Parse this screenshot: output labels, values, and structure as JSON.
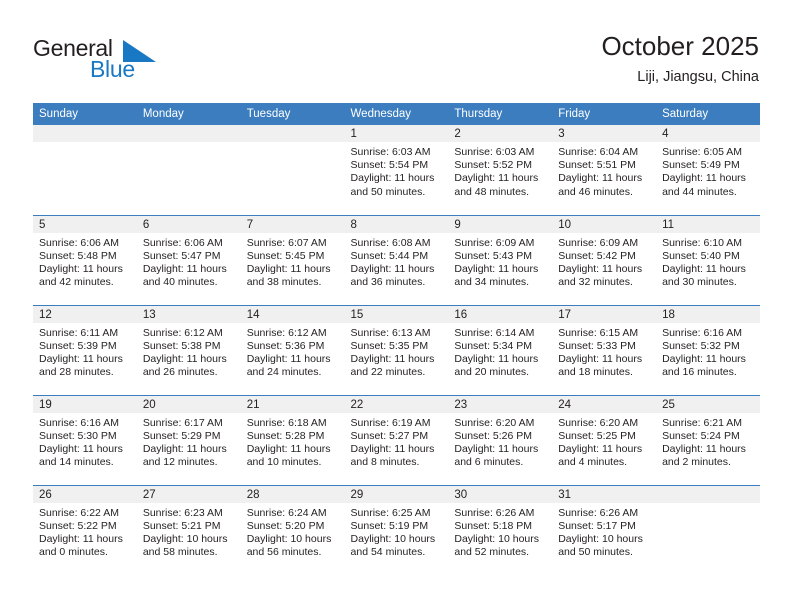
{
  "brand": {
    "name_part1": "General",
    "name_part2": "Blue",
    "accent_color": "#1878c4"
  },
  "header": {
    "title": "October 2025",
    "location": "Liji, Jiangsu, China"
  },
  "calendar": {
    "header_color": "#3b7dbf",
    "daynum_band_color": "#f0f0f0",
    "weekdays": [
      "Sunday",
      "Monday",
      "Tuesday",
      "Wednesday",
      "Thursday",
      "Friday",
      "Saturday"
    ],
    "weeks": [
      [
        {
          "day": "",
          "empty": true
        },
        {
          "day": "",
          "empty": true
        },
        {
          "day": "",
          "empty": true
        },
        {
          "day": "1",
          "sunrise": "Sunrise: 6:03 AM",
          "sunset": "Sunset: 5:54 PM",
          "daylight": "Daylight: 11 hours and 50 minutes."
        },
        {
          "day": "2",
          "sunrise": "Sunrise: 6:03 AM",
          "sunset": "Sunset: 5:52 PM",
          "daylight": "Daylight: 11 hours and 48 minutes."
        },
        {
          "day": "3",
          "sunrise": "Sunrise: 6:04 AM",
          "sunset": "Sunset: 5:51 PM",
          "daylight": "Daylight: 11 hours and 46 minutes."
        },
        {
          "day": "4",
          "sunrise": "Sunrise: 6:05 AM",
          "sunset": "Sunset: 5:49 PM",
          "daylight": "Daylight: 11 hours and 44 minutes."
        }
      ],
      [
        {
          "day": "5",
          "sunrise": "Sunrise: 6:06 AM",
          "sunset": "Sunset: 5:48 PM",
          "daylight": "Daylight: 11 hours and 42 minutes."
        },
        {
          "day": "6",
          "sunrise": "Sunrise: 6:06 AM",
          "sunset": "Sunset: 5:47 PM",
          "daylight": "Daylight: 11 hours and 40 minutes."
        },
        {
          "day": "7",
          "sunrise": "Sunrise: 6:07 AM",
          "sunset": "Sunset: 5:45 PM",
          "daylight": "Daylight: 11 hours and 38 minutes."
        },
        {
          "day": "8",
          "sunrise": "Sunrise: 6:08 AM",
          "sunset": "Sunset: 5:44 PM",
          "daylight": "Daylight: 11 hours and 36 minutes."
        },
        {
          "day": "9",
          "sunrise": "Sunrise: 6:09 AM",
          "sunset": "Sunset: 5:43 PM",
          "daylight": "Daylight: 11 hours and 34 minutes."
        },
        {
          "day": "10",
          "sunrise": "Sunrise: 6:09 AM",
          "sunset": "Sunset: 5:42 PM",
          "daylight": "Daylight: 11 hours and 32 minutes."
        },
        {
          "day": "11",
          "sunrise": "Sunrise: 6:10 AM",
          "sunset": "Sunset: 5:40 PM",
          "daylight": "Daylight: 11 hours and 30 minutes."
        }
      ],
      [
        {
          "day": "12",
          "sunrise": "Sunrise: 6:11 AM",
          "sunset": "Sunset: 5:39 PM",
          "daylight": "Daylight: 11 hours and 28 minutes."
        },
        {
          "day": "13",
          "sunrise": "Sunrise: 6:12 AM",
          "sunset": "Sunset: 5:38 PM",
          "daylight": "Daylight: 11 hours and 26 minutes."
        },
        {
          "day": "14",
          "sunrise": "Sunrise: 6:12 AM",
          "sunset": "Sunset: 5:36 PM",
          "daylight": "Daylight: 11 hours and 24 minutes."
        },
        {
          "day": "15",
          "sunrise": "Sunrise: 6:13 AM",
          "sunset": "Sunset: 5:35 PM",
          "daylight": "Daylight: 11 hours and 22 minutes."
        },
        {
          "day": "16",
          "sunrise": "Sunrise: 6:14 AM",
          "sunset": "Sunset: 5:34 PM",
          "daylight": "Daylight: 11 hours and 20 minutes."
        },
        {
          "day": "17",
          "sunrise": "Sunrise: 6:15 AM",
          "sunset": "Sunset: 5:33 PM",
          "daylight": "Daylight: 11 hours and 18 minutes."
        },
        {
          "day": "18",
          "sunrise": "Sunrise: 6:16 AM",
          "sunset": "Sunset: 5:32 PM",
          "daylight": "Daylight: 11 hours and 16 minutes."
        }
      ],
      [
        {
          "day": "19",
          "sunrise": "Sunrise: 6:16 AM",
          "sunset": "Sunset: 5:30 PM",
          "daylight": "Daylight: 11 hours and 14 minutes."
        },
        {
          "day": "20",
          "sunrise": "Sunrise: 6:17 AM",
          "sunset": "Sunset: 5:29 PM",
          "daylight": "Daylight: 11 hours and 12 minutes."
        },
        {
          "day": "21",
          "sunrise": "Sunrise: 6:18 AM",
          "sunset": "Sunset: 5:28 PM",
          "daylight": "Daylight: 11 hours and 10 minutes."
        },
        {
          "day": "22",
          "sunrise": "Sunrise: 6:19 AM",
          "sunset": "Sunset: 5:27 PM",
          "daylight": "Daylight: 11 hours and 8 minutes."
        },
        {
          "day": "23",
          "sunrise": "Sunrise: 6:20 AM",
          "sunset": "Sunset: 5:26 PM",
          "daylight": "Daylight: 11 hours and 6 minutes."
        },
        {
          "day": "24",
          "sunrise": "Sunrise: 6:20 AM",
          "sunset": "Sunset: 5:25 PM",
          "daylight": "Daylight: 11 hours and 4 minutes."
        },
        {
          "day": "25",
          "sunrise": "Sunrise: 6:21 AM",
          "sunset": "Sunset: 5:24 PM",
          "daylight": "Daylight: 11 hours and 2 minutes."
        }
      ],
      [
        {
          "day": "26",
          "sunrise": "Sunrise: 6:22 AM",
          "sunset": "Sunset: 5:22 PM",
          "daylight": "Daylight: 11 hours and 0 minutes."
        },
        {
          "day": "27",
          "sunrise": "Sunrise: 6:23 AM",
          "sunset": "Sunset: 5:21 PM",
          "daylight": "Daylight: 10 hours and 58 minutes."
        },
        {
          "day": "28",
          "sunrise": "Sunrise: 6:24 AM",
          "sunset": "Sunset: 5:20 PM",
          "daylight": "Daylight: 10 hours and 56 minutes."
        },
        {
          "day": "29",
          "sunrise": "Sunrise: 6:25 AM",
          "sunset": "Sunset: 5:19 PM",
          "daylight": "Daylight: 10 hours and 54 minutes."
        },
        {
          "day": "30",
          "sunrise": "Sunrise: 6:26 AM",
          "sunset": "Sunset: 5:18 PM",
          "daylight": "Daylight: 10 hours and 52 minutes."
        },
        {
          "day": "31",
          "sunrise": "Sunrise: 6:26 AM",
          "sunset": "Sunset: 5:17 PM",
          "daylight": "Daylight: 10 hours and 50 minutes."
        },
        {
          "day": "",
          "empty": true
        }
      ]
    ]
  }
}
